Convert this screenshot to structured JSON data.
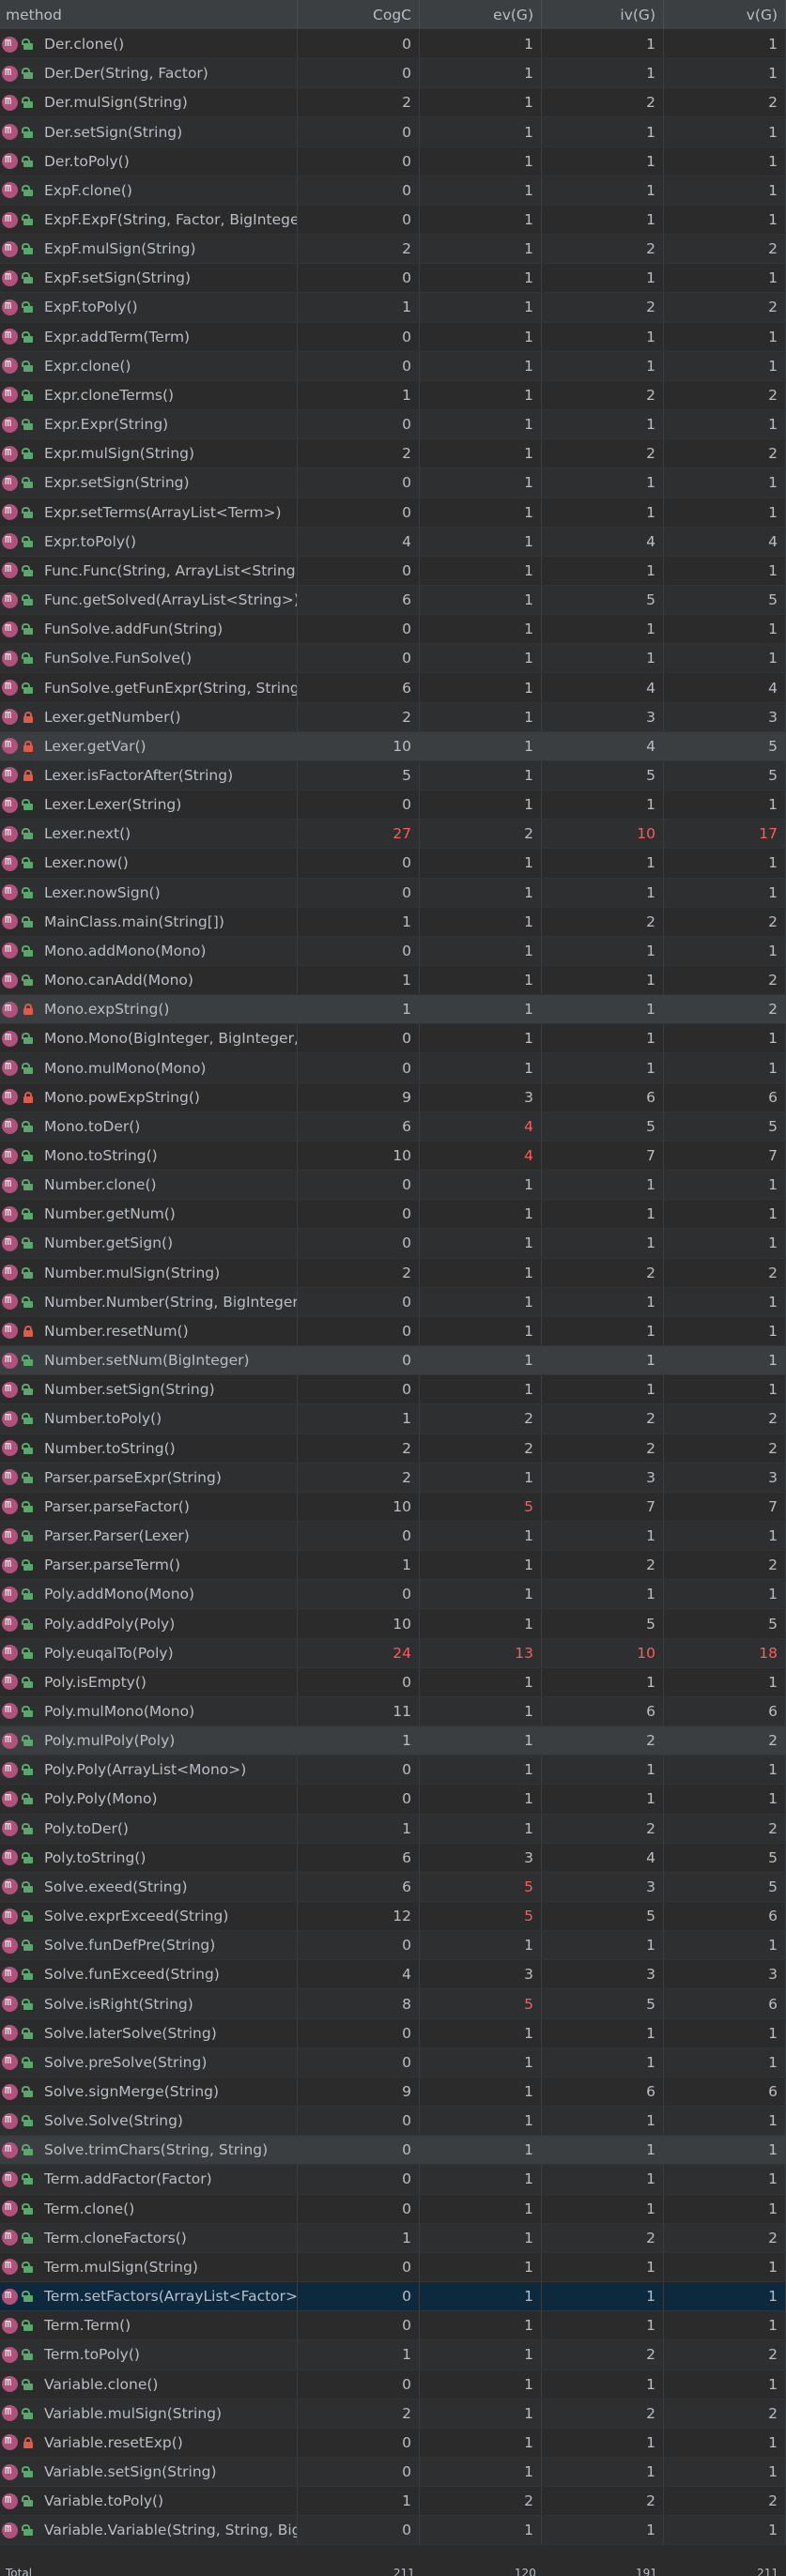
{
  "header": [
    "method",
    "CogC",
    "ev(G)",
    "iv(G)",
    "v(G)"
  ],
  "rows": [
    {
      "m": "Der.clone()",
      "v": [
        "0",
        "1",
        "1",
        "1"
      ],
      "acc": "pub"
    },
    {
      "m": "Der.Der(String, Factor)",
      "v": [
        "0",
        "1",
        "1",
        "1"
      ],
      "acc": "pub"
    },
    {
      "m": "Der.mulSign(String)",
      "v": [
        "2",
        "1",
        "2",
        "2"
      ],
      "acc": "pub"
    },
    {
      "m": "Der.setSign(String)",
      "v": [
        "0",
        "1",
        "1",
        "1"
      ],
      "acc": "pub"
    },
    {
      "m": "Der.toPoly()",
      "v": [
        "0",
        "1",
        "1",
        "1"
      ],
      "acc": "pub"
    },
    {
      "m": "ExpF.clone()",
      "v": [
        "0",
        "1",
        "1",
        "1"
      ],
      "acc": "pub"
    },
    {
      "m": "ExpF.ExpF(String, Factor, BigInteger)",
      "v": [
        "0",
        "1",
        "1",
        "1"
      ],
      "acc": "pub"
    },
    {
      "m": "ExpF.mulSign(String)",
      "v": [
        "2",
        "1",
        "2",
        "2"
      ],
      "acc": "pub"
    },
    {
      "m": "ExpF.setSign(String)",
      "v": [
        "0",
        "1",
        "1",
        "1"
      ],
      "acc": "pub"
    },
    {
      "m": "ExpF.toPoly()",
      "v": [
        "1",
        "1",
        "2",
        "2"
      ],
      "acc": "pub"
    },
    {
      "m": "Expr.addTerm(Term)",
      "v": [
        "0",
        "1",
        "1",
        "1"
      ],
      "acc": "pub"
    },
    {
      "m": "Expr.clone()",
      "v": [
        "0",
        "1",
        "1",
        "1"
      ],
      "acc": "pub"
    },
    {
      "m": "Expr.cloneTerms()",
      "v": [
        "1",
        "1",
        "2",
        "2"
      ],
      "acc": "pub"
    },
    {
      "m": "Expr.Expr(String)",
      "v": [
        "0",
        "1",
        "1",
        "1"
      ],
      "acc": "pub"
    },
    {
      "m": "Expr.mulSign(String)",
      "v": [
        "2",
        "1",
        "2",
        "2"
      ],
      "acc": "pub"
    },
    {
      "m": "Expr.setSign(String)",
      "v": [
        "0",
        "1",
        "1",
        "1"
      ],
      "acc": "pub"
    },
    {
      "m": "Expr.setTerms(ArrayList<Term>)",
      "v": [
        "0",
        "1",
        "1",
        "1"
      ],
      "acc": "pub"
    },
    {
      "m": "Expr.toPoly()",
      "v": [
        "4",
        "1",
        "4",
        "4"
      ],
      "acc": "pub"
    },
    {
      "m": "Func.Func(String, ArrayList<String>)",
      "v": [
        "0",
        "1",
        "1",
        "1"
      ],
      "acc": "pub"
    },
    {
      "m": "Func.getSolved(ArrayList<String>)",
      "v": [
        "6",
        "1",
        "5",
        "5"
      ],
      "acc": "pub"
    },
    {
      "m": "FunSolve.addFun(String)",
      "v": [
        "0",
        "1",
        "1",
        "1"
      ],
      "acc": "pub"
    },
    {
      "m": "FunSolve.FunSolve()",
      "v": [
        "0",
        "1",
        "1",
        "1"
      ],
      "acc": "pub"
    },
    {
      "m": "FunSolve.getFunExpr(String, String)",
      "v": [
        "6",
        "1",
        "4",
        "4"
      ],
      "acc": "pub"
    },
    {
      "m": "Lexer.getNumber()",
      "v": [
        "2",
        "1",
        "3",
        "3"
      ],
      "acc": "pri"
    },
    {
      "m": "Lexer.getVar()",
      "v": [
        "10",
        "1",
        "4",
        "5"
      ],
      "acc": "pri",
      "hl": true
    },
    {
      "m": "Lexer.isFactorAfter(String)",
      "v": [
        "5",
        "1",
        "5",
        "5"
      ],
      "acc": "pri"
    },
    {
      "m": "Lexer.Lexer(String)",
      "v": [
        "0",
        "1",
        "1",
        "1"
      ],
      "acc": "pub"
    },
    {
      "m": "Lexer.next()",
      "v": [
        "27",
        "2",
        "10",
        "17"
      ],
      "acc": "pub",
      "red": [
        0,
        2,
        3
      ]
    },
    {
      "m": "Lexer.now()",
      "v": [
        "0",
        "1",
        "1",
        "1"
      ],
      "acc": "pub"
    },
    {
      "m": "Lexer.nowSign()",
      "v": [
        "0",
        "1",
        "1",
        "1"
      ],
      "acc": "pub"
    },
    {
      "m": "MainClass.main(String[])",
      "v": [
        "1",
        "1",
        "2",
        "2"
      ],
      "acc": "pub"
    },
    {
      "m": "Mono.addMono(Mono)",
      "v": [
        "0",
        "1",
        "1",
        "1"
      ],
      "acc": "pub"
    },
    {
      "m": "Mono.canAdd(Mono)",
      "v": [
        "1",
        "1",
        "1",
        "2"
      ],
      "acc": "pub"
    },
    {
      "m": "Mono.expString()",
      "v": [
        "1",
        "1",
        "1",
        "2"
      ],
      "acc": "pri",
      "hl": true
    },
    {
      "m": "Mono.Mono(BigInteger, BigInteger, BigInteger)",
      "v": [
        "0",
        "1",
        "1",
        "1"
      ],
      "acc": "pub"
    },
    {
      "m": "Mono.mulMono(Mono)",
      "v": [
        "0",
        "1",
        "1",
        "1"
      ],
      "acc": "pub"
    },
    {
      "m": "Mono.powExpString()",
      "v": [
        "9",
        "3",
        "6",
        "6"
      ],
      "acc": "pri"
    },
    {
      "m": "Mono.toDer()",
      "v": [
        "6",
        "4",
        "5",
        "5"
      ],
      "acc": "pub",
      "red": [
        1
      ]
    },
    {
      "m": "Mono.toString()",
      "v": [
        "10",
        "4",
        "7",
        "7"
      ],
      "acc": "pub",
      "red": [
        1
      ]
    },
    {
      "m": "Number.clone()",
      "v": [
        "0",
        "1",
        "1",
        "1"
      ],
      "acc": "pub"
    },
    {
      "m": "Number.getNum()",
      "v": [
        "0",
        "1",
        "1",
        "1"
      ],
      "acc": "pub"
    },
    {
      "m": "Number.getSign()",
      "v": [
        "0",
        "1",
        "1",
        "1"
      ],
      "acc": "pub"
    },
    {
      "m": "Number.mulSign(String)",
      "v": [
        "2",
        "1",
        "2",
        "2"
      ],
      "acc": "pub"
    },
    {
      "m": "Number.Number(String, BigInteger)",
      "v": [
        "0",
        "1",
        "1",
        "1"
      ],
      "acc": "pub"
    },
    {
      "m": "Number.resetNum()",
      "v": [
        "0",
        "1",
        "1",
        "1"
      ],
      "acc": "pri"
    },
    {
      "m": "Number.setNum(BigInteger)",
      "v": [
        "0",
        "1",
        "1",
        "1"
      ],
      "acc": "pub",
      "hl": true
    },
    {
      "m": "Number.setSign(String)",
      "v": [
        "0",
        "1",
        "1",
        "1"
      ],
      "acc": "pub"
    },
    {
      "m": "Number.toPoly()",
      "v": [
        "1",
        "2",
        "2",
        "2"
      ],
      "acc": "pub"
    },
    {
      "m": "Number.toString()",
      "v": [
        "2",
        "2",
        "2",
        "2"
      ],
      "acc": "pub"
    },
    {
      "m": "Parser.parseExpr(String)",
      "v": [
        "2",
        "1",
        "3",
        "3"
      ],
      "acc": "pub"
    },
    {
      "m": "Parser.parseFactor()",
      "v": [
        "10",
        "5",
        "7",
        "7"
      ],
      "acc": "pub",
      "red": [
        1
      ]
    },
    {
      "m": "Parser.Parser(Lexer)",
      "v": [
        "0",
        "1",
        "1",
        "1"
      ],
      "acc": "pub"
    },
    {
      "m": "Parser.parseTerm()",
      "v": [
        "1",
        "1",
        "2",
        "2"
      ],
      "acc": "pub"
    },
    {
      "m": "Poly.addMono(Mono)",
      "v": [
        "0",
        "1",
        "1",
        "1"
      ],
      "acc": "pub"
    },
    {
      "m": "Poly.addPoly(Poly)",
      "v": [
        "10",
        "1",
        "5",
        "5"
      ],
      "acc": "pub"
    },
    {
      "m": "Poly.euqalTo(Poly)",
      "v": [
        "24",
        "13",
        "10",
        "18"
      ],
      "acc": "pub",
      "red": [
        0,
        1,
        2,
        3
      ]
    },
    {
      "m": "Poly.isEmpty()",
      "v": [
        "0",
        "1",
        "1",
        "1"
      ],
      "acc": "pub"
    },
    {
      "m": "Poly.mulMono(Mono)",
      "v": [
        "11",
        "1",
        "6",
        "6"
      ],
      "acc": "pub"
    },
    {
      "m": "Poly.mulPoly(Poly)",
      "v": [
        "1",
        "1",
        "2",
        "2"
      ],
      "acc": "pub",
      "hl": true
    },
    {
      "m": "Poly.Poly(ArrayList<Mono>)",
      "v": [
        "0",
        "1",
        "1",
        "1"
      ],
      "acc": "pub"
    },
    {
      "m": "Poly.Poly(Mono)",
      "v": [
        "0",
        "1",
        "1",
        "1"
      ],
      "acc": "pub"
    },
    {
      "m": "Poly.toDer()",
      "v": [
        "1",
        "1",
        "2",
        "2"
      ],
      "acc": "pub"
    },
    {
      "m": "Poly.toString()",
      "v": [
        "6",
        "3",
        "4",
        "5"
      ],
      "acc": "pub"
    },
    {
      "m": "Solve.exeed(String)",
      "v": [
        "6",
        "5",
        "3",
        "5"
      ],
      "acc": "pub",
      "red": [
        1
      ]
    },
    {
      "m": "Solve.exprExceed(String)",
      "v": [
        "12",
        "5",
        "5",
        "6"
      ],
      "acc": "pub",
      "red": [
        1
      ]
    },
    {
      "m": "Solve.funDefPre(String)",
      "v": [
        "0",
        "1",
        "1",
        "1"
      ],
      "acc": "pub"
    },
    {
      "m": "Solve.funExceed(String)",
      "v": [
        "4",
        "3",
        "3",
        "3"
      ],
      "acc": "pub"
    },
    {
      "m": "Solve.isRight(String)",
      "v": [
        "8",
        "5",
        "5",
        "6"
      ],
      "acc": "pub",
      "red": [
        1
      ]
    },
    {
      "m": "Solve.laterSolve(String)",
      "v": [
        "0",
        "1",
        "1",
        "1"
      ],
      "acc": "pub"
    },
    {
      "m": "Solve.preSolve(String)",
      "v": [
        "0",
        "1",
        "1",
        "1"
      ],
      "acc": "pub"
    },
    {
      "m": "Solve.signMerge(String)",
      "v": [
        "9",
        "1",
        "6",
        "6"
      ],
      "acc": "pub"
    },
    {
      "m": "Solve.Solve(String)",
      "v": [
        "0",
        "1",
        "1",
        "1"
      ],
      "acc": "pub"
    },
    {
      "m": "Solve.trimChars(String, String)",
      "v": [
        "0",
        "1",
        "1",
        "1"
      ],
      "acc": "pub",
      "hl": true
    },
    {
      "m": "Term.addFactor(Factor)",
      "v": [
        "0",
        "1",
        "1",
        "1"
      ],
      "acc": "pub"
    },
    {
      "m": "Term.clone()",
      "v": [
        "0",
        "1",
        "1",
        "1"
      ],
      "acc": "pub"
    },
    {
      "m": "Term.cloneFactors()",
      "v": [
        "1",
        "1",
        "2",
        "2"
      ],
      "acc": "pub"
    },
    {
      "m": "Term.mulSign(String)",
      "v": [
        "0",
        "1",
        "1",
        "1"
      ],
      "acc": "pub"
    },
    {
      "m": "Term.setFactors(ArrayList<Factor>)",
      "v": [
        "0",
        "1",
        "1",
        "1"
      ],
      "acc": "pub",
      "sel": true
    },
    {
      "m": "Term.Term()",
      "v": [
        "0",
        "1",
        "1",
        "1"
      ],
      "acc": "pub"
    },
    {
      "m": "Term.toPoly()",
      "v": [
        "1",
        "1",
        "2",
        "2"
      ],
      "acc": "pub"
    },
    {
      "m": "Variable.clone()",
      "v": [
        "0",
        "1",
        "1",
        "1"
      ],
      "acc": "pub"
    },
    {
      "m": "Variable.mulSign(String)",
      "v": [
        "2",
        "1",
        "2",
        "2"
      ],
      "acc": "pub"
    },
    {
      "m": "Variable.resetExp()",
      "v": [
        "0",
        "1",
        "1",
        "1"
      ],
      "acc": "pri"
    },
    {
      "m": "Variable.setSign(String)",
      "v": [
        "0",
        "1",
        "1",
        "1"
      ],
      "acc": "pub"
    },
    {
      "m": "Variable.toPoly()",
      "v": [
        "1",
        "2",
        "2",
        "2"
      ],
      "acc": "pub"
    },
    {
      "m": "Variable.Variable(String, String, BigInteger)",
      "v": [
        "0",
        "1",
        "1",
        "1"
      ],
      "acc": "pub"
    }
  ],
  "total": {
    "label": "Total",
    "values": [
      "211",
      "120",
      "191",
      "211"
    ]
  },
  "colors": {
    "red": "#ff5b5b",
    "public": "#59a869",
    "private": "#e05a47",
    "method_icon": "#b0527c"
  }
}
